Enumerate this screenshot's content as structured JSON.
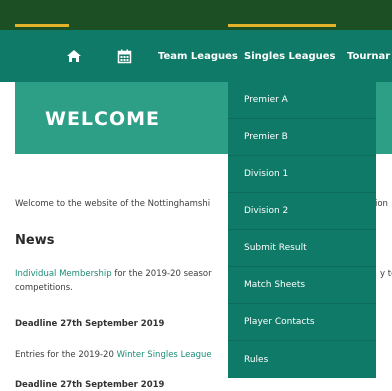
{
  "colors": {
    "nav_bg": "#0f7a67",
    "top_strip": "#1c4f24",
    "accent_gold": "#e2b32a",
    "hero_bg": "#2c9f86",
    "link": "#1a8c77"
  },
  "nav": {
    "home_icon": "home-icon",
    "calendar_icon": "calendar-icon",
    "team_leagues": "Team Leagues",
    "singles_leagues": "Singles Leagues",
    "tournaments": "Tournar"
  },
  "hero": {
    "title": "WELCOME"
  },
  "content": {
    "welcome_start": "Welcome to the website of the Nottinghamshi",
    "welcome_end": "ion",
    "news_heading": "News",
    "membership_link": "Individual Membership",
    "membership_text": " for the 2019-20 seasor",
    "membership_end": "y to",
    "competitions": "competitions.",
    "deadline_1": "Deadline 27th September 2019",
    "entries_text": "Entries for the 2019-20 ",
    "entries_link": "Winter Singles League",
    "deadline_2": "Deadline 27th September 2019"
  },
  "dropdown": {
    "items": [
      "Premier A",
      "Premier B",
      "Division 1",
      "Division 2",
      "Submit Result",
      "Match Sheets",
      "Player Contacts",
      "Rules"
    ]
  }
}
